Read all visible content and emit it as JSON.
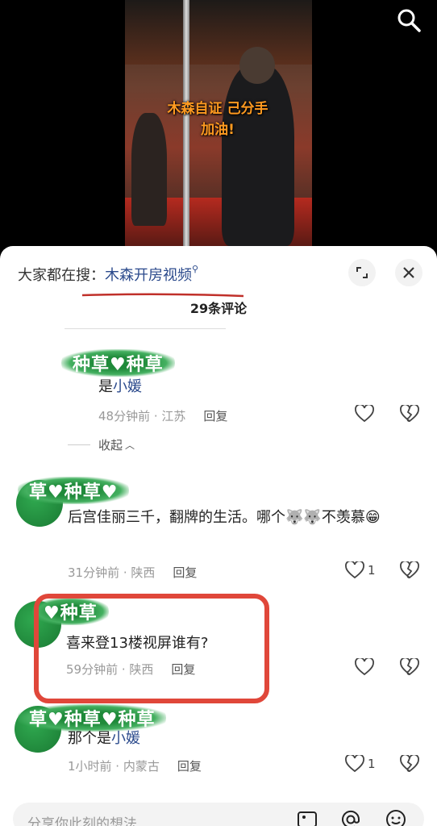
{
  "video": {
    "caption_line1": "木森自证 己分手",
    "caption_line2": "加油!"
  },
  "sheet": {
    "hot_search_label": "大家都在搜：",
    "hot_search_keyword": "木森开房视频",
    "comment_count": "29条评论",
    "collapse_label": "收起",
    "input_placeholder": "分享你此刻的想法"
  },
  "comments": [
    {
      "name": "种草♥种草",
      "text": "是",
      "link": "小媛",
      "time": "48分钟前 · 江苏",
      "reply": "回复",
      "likes": ""
    },
    {
      "name": "草♥种草♥",
      "text": "后宫佳丽三千，翻牌的生活。哪个🐺🐺不羡慕😁",
      "time": "31分钟前 · 陕西",
      "reply": "回复",
      "likes": "1"
    },
    {
      "name": "♥种草",
      "text": "喜来登13楼视屏谁有?",
      "time": "59分钟前 · 陕西",
      "reply": "回复",
      "likes": ""
    },
    {
      "name": "草♥种草♥种草",
      "text": "那个是",
      "link": "小媛",
      "time": "1小时前 · 内蒙古",
      "reply": "回复",
      "likes": "1"
    }
  ],
  "colors": {
    "accent": "#2b4a8c",
    "highlight": "#e0473a",
    "avatar_green": "#1f8a3a"
  }
}
